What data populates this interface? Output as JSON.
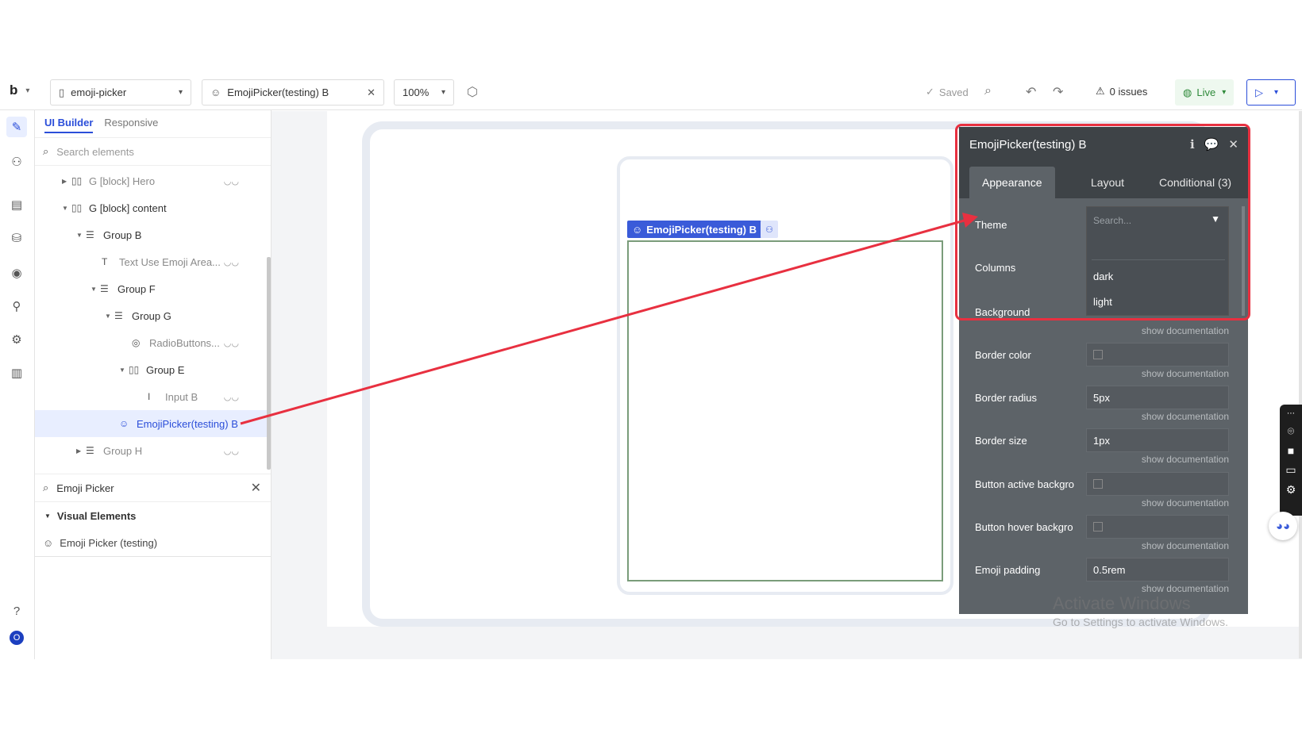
{
  "topbar": {
    "logo": "b",
    "app_selector": "emoji-picker",
    "page_selector": "EmojiPicker(testing) B",
    "zoom": "100%",
    "saved": "Saved",
    "issues": "0 issues",
    "live": "Live"
  },
  "tree": {
    "tab_builder": "UI Builder",
    "tab_responsive": "Responsive",
    "search_placeholder": "Search elements",
    "items": [
      {
        "label": "G [block] Hero"
      },
      {
        "label": "G [block] content"
      },
      {
        "label": "Group B"
      },
      {
        "label": "Text Use Emoji Area..."
      },
      {
        "label": "Group F"
      },
      {
        "label": "Group G"
      },
      {
        "label": "RadioButtons..."
      },
      {
        "label": "Group E"
      },
      {
        "label": "Input B"
      },
      {
        "label": "EmojiPicker(testing) B"
      },
      {
        "label": "Group H"
      }
    ],
    "library_search": "Emoji Picker",
    "library_section": "Visual Elements",
    "library_item": "Emoji Picker (testing)"
  },
  "canvas": {
    "selected_label": "EmojiPicker(testing) B"
  },
  "editor": {
    "title": "EmojiPicker(testing) B",
    "tabs": [
      "Appearance",
      "Layout",
      "Conditional (3)"
    ],
    "theme_label": "Theme",
    "theme_search": "Search...",
    "theme_options": [
      "dark",
      "light"
    ],
    "columns_label": "Columns",
    "background_label": "Background",
    "doc": "show documentation",
    "border_color_label": "Border color",
    "border_radius_label": "Border radius",
    "border_radius_value": "5px",
    "border_size_label": "Border size",
    "border_size_value": "1px",
    "button_active_label": "Button active backgro",
    "button_hover_label": "Button hover backgro",
    "emoji_padding_label": "Emoji padding",
    "emoji_padding_value": "0.5rem"
  },
  "watermark": {
    "line1": "Activate Windows",
    "line2": "Go to Settings to activate Windows."
  },
  "colors": {
    "accent": "#2b4ed9",
    "highlight": "#e83040",
    "editor_bg": "#5d6368"
  }
}
